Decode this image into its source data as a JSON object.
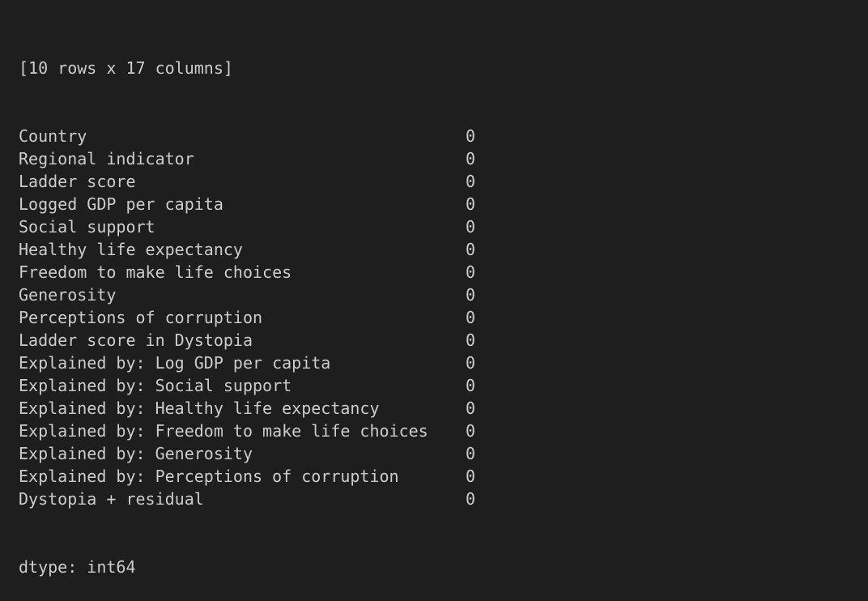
{
  "header": "[10 rows x 17 columns]",
  "rows": [
    {
      "name": "Country",
      "value": "0"
    },
    {
      "name": "Regional indicator",
      "value": "0"
    },
    {
      "name": "Ladder score",
      "value": "0"
    },
    {
      "name": "Logged GDP per capita",
      "value": "0"
    },
    {
      "name": "Social support",
      "value": "0"
    },
    {
      "name": "Healthy life expectancy",
      "value": "0"
    },
    {
      "name": "Freedom to make life choices",
      "value": "0"
    },
    {
      "name": "Generosity",
      "value": "0"
    },
    {
      "name": "Perceptions of corruption",
      "value": "0"
    },
    {
      "name": "Ladder score in Dystopia",
      "value": "0"
    },
    {
      "name": "Explained by: Log GDP per capita",
      "value": "0"
    },
    {
      "name": "Explained by: Social support",
      "value": "0"
    },
    {
      "name": "Explained by: Healthy life expectancy",
      "value": "0"
    },
    {
      "name": "Explained by: Freedom to make life choices",
      "value": "0"
    },
    {
      "name": "Explained by: Generosity",
      "value": "0"
    },
    {
      "name": "Explained by: Perceptions of corruption",
      "value": "0"
    },
    {
      "name": "Dystopia + residual",
      "value": "0"
    }
  ],
  "footer": "dtype: int64"
}
